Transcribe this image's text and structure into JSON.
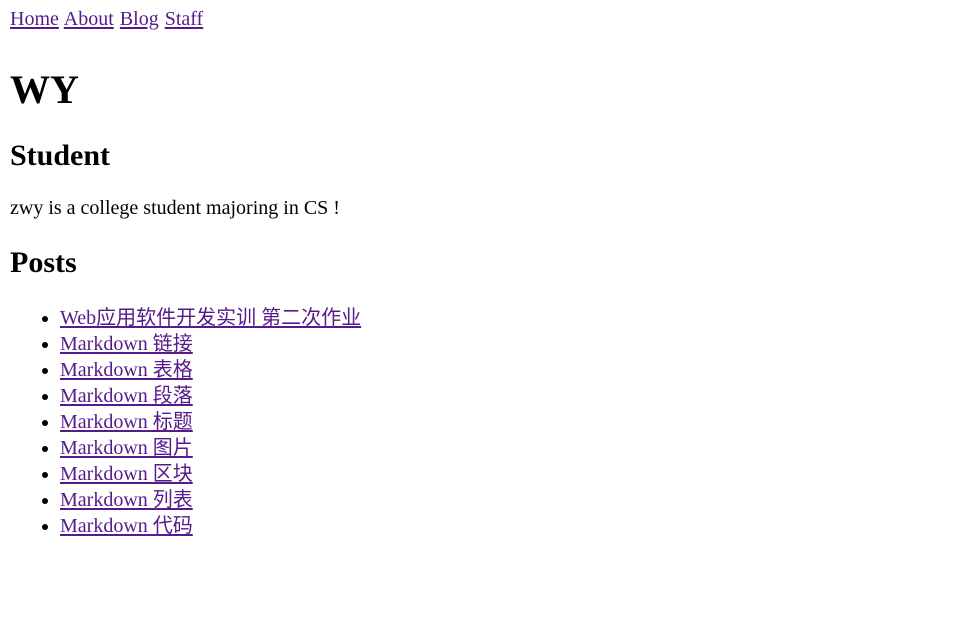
{
  "nav": {
    "links": [
      "Home",
      "About",
      "Blog",
      "Staff"
    ]
  },
  "site": {
    "title": "WY"
  },
  "profile": {
    "role": "Student",
    "bio": "zwy is a college student majoring in CS !"
  },
  "posts": {
    "heading": "Posts",
    "items": [
      "Web应用软件开发实训 第二次作业",
      "Markdown 链接",
      "Markdown 表格",
      "Markdown 段落",
      "Markdown 标题",
      "Markdown 图片",
      "Markdown 区块",
      "Markdown 列表",
      "Markdown 代码"
    ]
  },
  "colors": {
    "link": "#551a8b",
    "text": "#000000",
    "background": "#ffffff"
  }
}
